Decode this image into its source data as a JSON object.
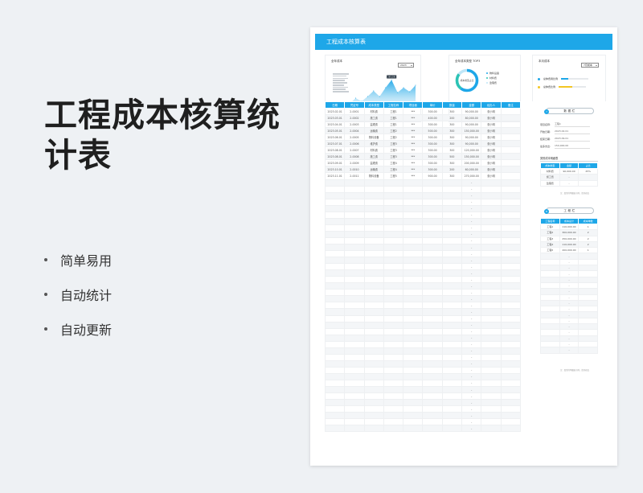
{
  "promo": {
    "title": "工程成本核算统计表",
    "bullets": [
      "简单易用",
      "自动统计",
      "自动更新"
    ]
  },
  "sheet": {
    "title": "工程成本核算表",
    "colors": {
      "accent": "#1ea7e8",
      "yellow": "#f3c623",
      "teal": "#2cc3b5"
    },
    "panel_annual": {
      "title": "全年成本",
      "year": "2023",
      "peak_label": "295,000",
      "months": [
        "1月",
        "2月",
        "3月",
        "4月",
        "5月",
        "6月",
        "7月",
        "8月",
        "9月",
        "10月",
        "11月",
        "12月"
      ]
    },
    "panel_type": {
      "title": "全年成本类型 TOP3",
      "center_label": "成本类型占比",
      "legend": [
        "物料设备",
        "材料费",
        "监理费"
      ]
    },
    "panel_project": {
      "title": "本月成本",
      "month": "7月成本",
      "rows": [
        {
          "name": "总体费用比例",
          "fill": 0.25
        },
        {
          "name": "总体费比例",
          "fill": 0.5
        }
      ]
    },
    "table": {
      "headers": [
        "日期",
        "凭证号",
        "成本类型",
        "工程名称",
        "项目面",
        "单价",
        "数量",
        "金额",
        "经办人",
        "备注"
      ],
      "rows": [
        [
          "2023.02.01",
          "2-0001",
          "材料费",
          "工程1",
          "***",
          "300.00",
          "300",
          "90,000.00",
          "张小明",
          ""
        ],
        [
          "2023.03.01",
          "2-0002",
          "施工费",
          "工程1",
          "***",
          "400.00",
          "200",
          "80,000.00",
          "张小明",
          ""
        ],
        [
          "2023.04.01",
          "2-0003",
          "监理费",
          "工程1",
          "***",
          "300.00",
          "300",
          "90,000.00",
          "张小明",
          ""
        ],
        [
          "2023.05.01",
          "2-0004",
          "运输费",
          "工程2",
          "***",
          "500.00",
          "300",
          "150,000.00",
          "张小明",
          ""
        ],
        [
          "2023.06.01",
          "2-0005",
          "物料设备",
          "工程2",
          "***",
          "300.00",
          "300",
          "90,000.00",
          "张小明",
          ""
        ],
        [
          "2023.07.01",
          "2-0006",
          "维护费",
          "工程3",
          "***",
          "300.00",
          "300",
          "90,000.00",
          "张小明",
          ""
        ],
        [
          "2023.08.01",
          "2-0007",
          "材料费",
          "工程3",
          "***",
          "300.00",
          "300",
          "120,000.00",
          "张小明",
          ""
        ],
        [
          "2023.08.01",
          "2-0008",
          "施工费",
          "工程3",
          "***",
          "300.00",
          "500",
          "150,000.00",
          "张小明",
          ""
        ],
        [
          "2023.09.01",
          "2-0009",
          "监理费",
          "工程4",
          "***",
          "300.00",
          "300",
          "200,000.00",
          "张小明",
          ""
        ],
        [
          "2023.10.01",
          "2-0010",
          "运输费",
          "工程4",
          "***",
          "300.00",
          "200",
          "60,000.00",
          "张小明",
          ""
        ],
        [
          "2023.11.01",
          "2-0011",
          "物料设备",
          "工程5",
          "***",
          "900.00",
          "300",
          "270,000.00",
          "张小明",
          ""
        ]
      ],
      "empty_rows": 39,
      "empty_placeholder": "-"
    },
    "side_info": {
      "badge": "?",
      "pill": "数据栏",
      "fields": [
        {
          "label": "项目名称:",
          "value": "工程1"
        },
        {
          "label": "开始日期:",
          "value": "2023.02.01"
        },
        {
          "label": "结束日期:",
          "value": "2023.09.01"
        },
        {
          "label": "最多支出:",
          "value": "150,000.00"
        }
      ],
      "type_label": "类别成本明细表",
      "type_headers": [
        "成本类型",
        "金额",
        "占比"
      ],
      "type_rows": [
        [
          "材料费",
          "90,000.00",
          "25%"
        ],
        [
          "施工费",
          "-",
          ""
        ],
        [
          "监理费",
          "-",
          ""
        ]
      ],
      "note": "注：类型的明细表示例，请勿修改"
    },
    "side_proj": {
      "badge": "8",
      "pill": "工程栏",
      "headers": [
        "工程名称",
        "成本总计",
        "成本单数"
      ],
      "rows": [
        [
          "工程1",
          "110,000.00",
          "1"
        ],
        [
          "工程2",
          "300,000.00",
          "2"
        ],
        [
          "工程3",
          "250,000.00",
          "2"
        ],
        [
          "工程4",
          "110,000.00",
          "2"
        ],
        [
          "工程5",
          "200,000.00",
          "1"
        ]
      ],
      "empty_rows": 17,
      "empty_placeholder": "-",
      "note": "注：类型的明细表示例，请勿修改"
    }
  },
  "chart_data": [
    {
      "type": "area",
      "title": "全年成本",
      "categories": [
        "1月",
        "2月",
        "3月",
        "4月",
        "5月",
        "6月",
        "7月",
        "8月",
        "9月",
        "10月",
        "11月",
        "12月"
      ],
      "values": [
        0,
        70000,
        30000,
        90000,
        160000,
        90000,
        200000,
        295000,
        140000,
        200000,
        150000,
        230000
      ],
      "ylim": [
        0,
        320000
      ]
    },
    {
      "type": "pie",
      "title": "全年成本类型 TOP3",
      "categories": [
        "物料设备",
        "材料费",
        "监理费"
      ],
      "values": [
        60,
        25,
        15
      ]
    }
  ]
}
